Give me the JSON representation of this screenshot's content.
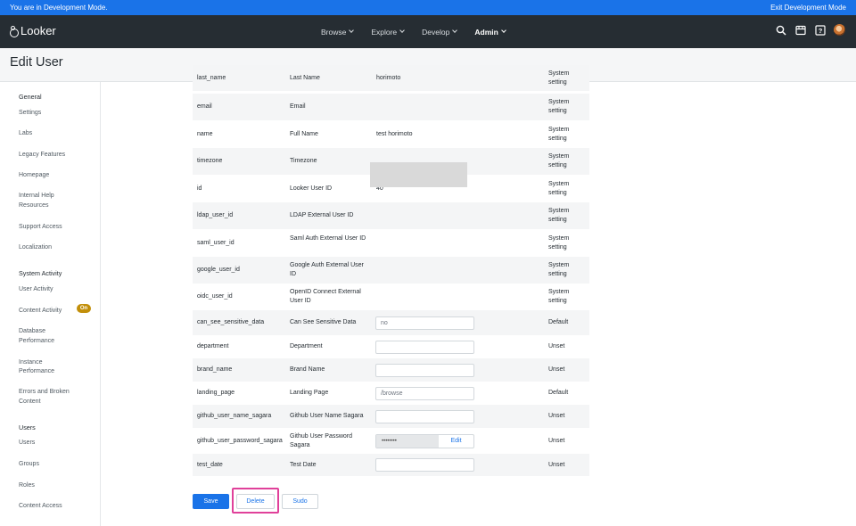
{
  "dev_banner": {
    "message": "You are in Development Mode.",
    "exit_label": "Exit Development Mode"
  },
  "nav": {
    "logo_text": "Looker",
    "menu": [
      "Browse",
      "Explore",
      "Develop",
      "Admin"
    ],
    "active": "Admin",
    "icons": [
      "search-icon",
      "marketplace-icon",
      "help-icon",
      "avatar"
    ]
  },
  "page": {
    "title": "Edit User"
  },
  "sidebar": {
    "items": [
      {
        "label": "General",
        "type": "head"
      },
      {
        "label": "Settings",
        "type": "link"
      },
      {
        "label": "Labs",
        "type": "link"
      },
      {
        "label": "Legacy Features",
        "type": "link"
      },
      {
        "label": "Homepage",
        "type": "link"
      },
      {
        "label": "Internal Help",
        "type": "link"
      },
      {
        "label": "Resources",
        "type": "link"
      },
      {
        "label": "Support Access",
        "type": "link",
        "badge": "On"
      },
      {
        "label": "Localization",
        "type": "link"
      },
      {
        "label": "System Activity",
        "type": "head"
      },
      {
        "label": "User Activity",
        "type": "link"
      },
      {
        "label": "Content Activity",
        "type": "link"
      },
      {
        "label": "Database",
        "type": "link"
      },
      {
        "label": "Performance",
        "type": "link"
      },
      {
        "label": "Instance",
        "type": "link"
      },
      {
        "label": "Performance",
        "type": "link"
      },
      {
        "label": "Errors and Broken",
        "type": "link"
      },
      {
        "label": "Content",
        "type": "link"
      },
      {
        "label": "Users",
        "type": "head"
      },
      {
        "label": "Users",
        "type": "link"
      },
      {
        "label": "Groups",
        "type": "link"
      },
      {
        "label": "Roles",
        "type": "link"
      },
      {
        "label": "Content Access",
        "type": "link"
      }
    ]
  },
  "attributes": {
    "rows": [
      {
        "name": "last_name",
        "label": "Last Name",
        "value": "horimoto",
        "source": "System setting"
      },
      {
        "name": "email",
        "label": "Email",
        "value": "",
        "source": "System setting"
      },
      {
        "name": "name",
        "label": "Full Name",
        "value": "test horimoto",
        "source": "System setting"
      },
      {
        "name": "timezone",
        "label": "Timezone",
        "value": "",
        "source": "System setting"
      },
      {
        "name": "id",
        "label": "Looker User ID",
        "value": "40",
        "source": "System setting"
      },
      {
        "name": "ldap_user_id",
        "label": "LDAP External User ID",
        "value": "",
        "source": "System setting"
      },
      {
        "name": "saml_user_id",
        "label": "Saml Auth External User ID",
        "value": "",
        "source": "System setting"
      },
      {
        "name": "google_user_id",
        "label": "Google Auth External User ID",
        "value": "",
        "source": "System setting"
      },
      {
        "name": "oidc_user_id",
        "label": "OpenID Connect External User ID",
        "value": "",
        "source": "System setting"
      },
      {
        "name": "can_see_sensitive_data",
        "label": "Can See Sensitive Data",
        "input": "no",
        "source": "Default"
      },
      {
        "name": "department",
        "label": "Department",
        "input": "",
        "source": "Unset"
      },
      {
        "name": "brand_name",
        "label": "Brand Name",
        "input": "",
        "source": "Unset"
      },
      {
        "name": "landing_page",
        "label": "Landing Page",
        "input": "/browse",
        "source": "Default"
      },
      {
        "name": "github_user_name_sagara",
        "label": "Github User Name Sagara",
        "input": "",
        "source": "Unset"
      },
      {
        "name": "github_user_password_sagara",
        "label": "Github User Password Sagara",
        "masked": "••••••••",
        "edit_label": "Edit",
        "source": "Unset"
      },
      {
        "name": "test_date",
        "label": "Test Date",
        "input": "",
        "source": "Unset"
      }
    ]
  },
  "actions": {
    "save": "Save",
    "delete": "Delete",
    "sudo": "Sudo"
  },
  "colors": {
    "primary": "#1a73e8",
    "topnav": "#262d33",
    "highlight": "#e0409a",
    "badge": "#c28f0a"
  }
}
